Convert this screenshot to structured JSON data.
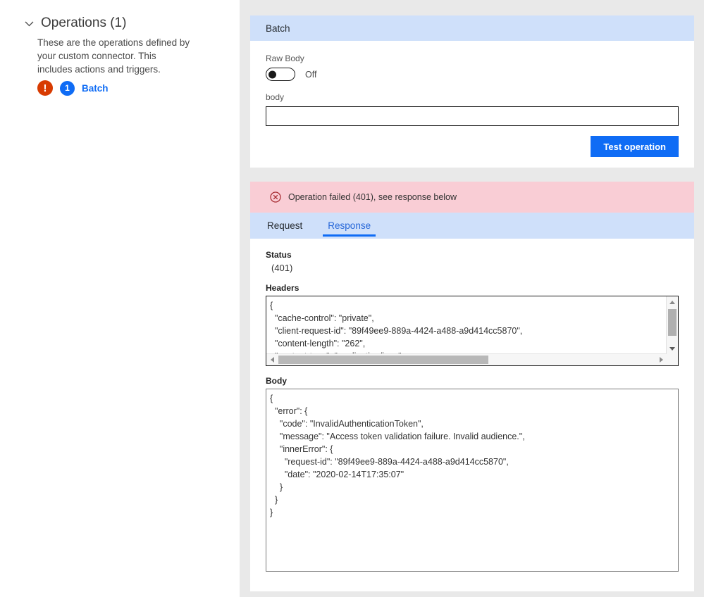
{
  "sidebar": {
    "chevron_icon": "chevron-down-icon",
    "title": "Operations (1)",
    "description": "These are the operations defined by your custom connector. This includes actions and triggers.",
    "operation": {
      "error_icon": "!",
      "count_badge": "1",
      "label": "Batch"
    }
  },
  "batch_panel": {
    "title": "Batch",
    "raw_body_label": "Raw Body",
    "raw_body_state": "Off",
    "body_label": "body",
    "body_value": "",
    "body_placeholder": "",
    "test_button": "Test operation"
  },
  "response_panel": {
    "error_banner": {
      "icon": "error-circle-x-icon",
      "message": "Operation failed (401), see response below"
    },
    "tabs": [
      {
        "label": "Request",
        "active": false
      },
      {
        "label": "Response",
        "active": true
      }
    ],
    "status_label": "Status",
    "status_value": "(401)",
    "headers_label": "Headers",
    "headers_text": "{\n  \"cache-control\": \"private\",\n  \"client-request-id\": \"89f49ee9-889a-4424-a488-a9d414cc5870\",\n  \"content-length\": \"262\",\n  \"content-type\": \"application/json\",",
    "body_label": "Body",
    "body_text": "{\n  \"error\": {\n    \"code\": \"InvalidAuthenticationToken\",\n    \"message\": \"Access token validation failure. Invalid audience.\",\n    \"innerError\": {\n      \"request-id\": \"89f49ee9-889a-4424-a488-a9d414cc5870\",\n      \"date\": \"2020-02-14T17:35:07\"\n    }\n  }\n}"
  },
  "colors": {
    "accent_blue": "#0f6cf5",
    "panel_header_blue": "#cfe0fa",
    "error_pink": "#f9cdd5",
    "error_red": "#d83b01",
    "page_gray": "#e9e9e9"
  }
}
